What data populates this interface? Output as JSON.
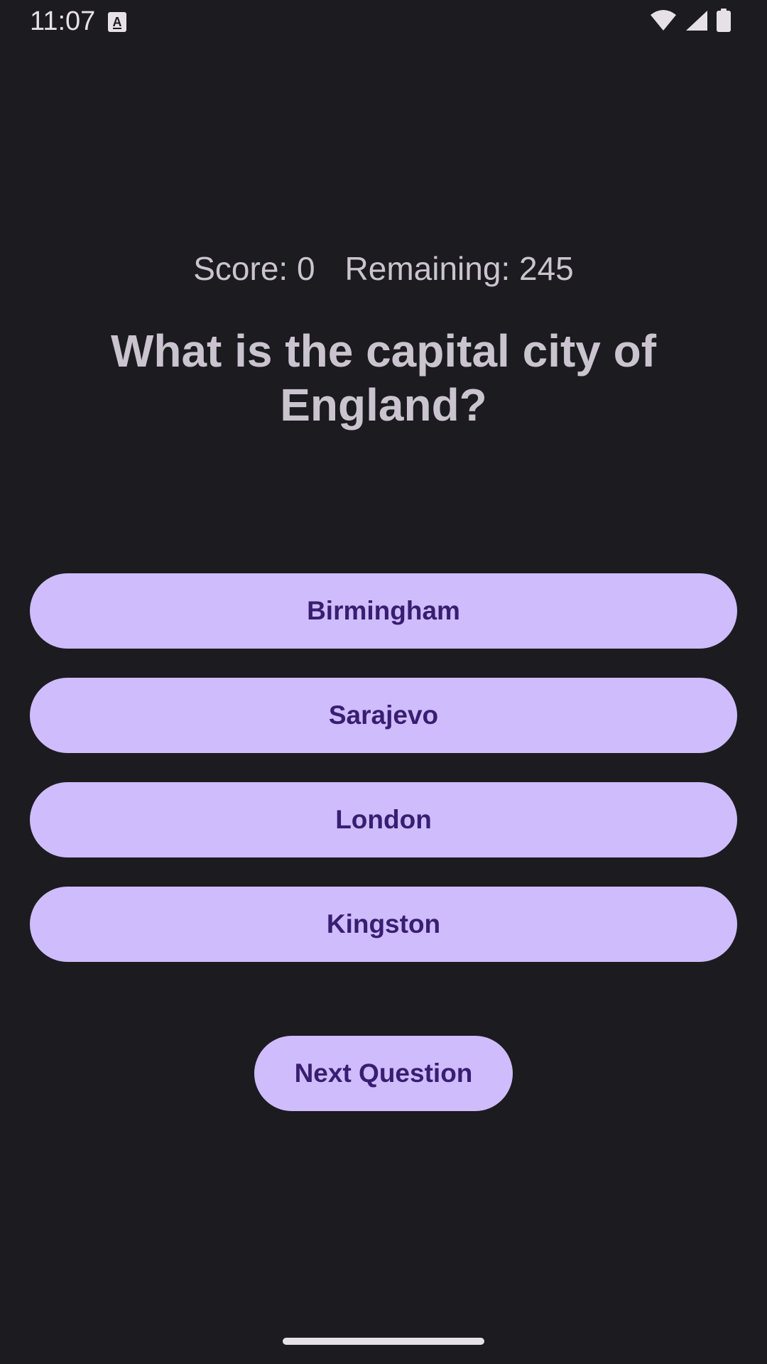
{
  "status_bar": {
    "time": "11:07",
    "notification_icon": "a-keyboard-icon",
    "icons": [
      "wifi-icon",
      "signal-icon",
      "battery-icon"
    ]
  },
  "quiz": {
    "score_label": "Score: 0",
    "remaining_label": "Remaining: 245",
    "question": "What is the capital city of England?",
    "answers": [
      "Birmingham",
      "Sarajevo",
      "London",
      "Kingston"
    ],
    "next_label": "Next Question"
  },
  "colors": {
    "background": "#1c1b20",
    "button_fill": "#cfbcfc",
    "button_text": "#381e72",
    "text_muted": "#cac4cf"
  }
}
